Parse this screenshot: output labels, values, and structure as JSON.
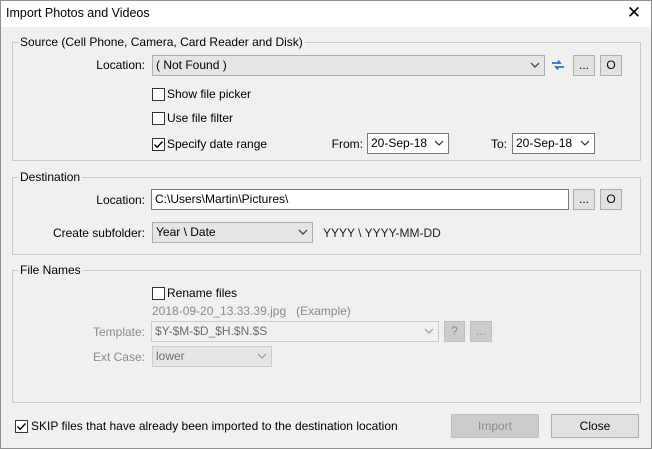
{
  "window": {
    "title": "Import Photos and Videos",
    "close_glyph": "✕"
  },
  "source": {
    "legend": "Source (Cell Phone, Camera, Card Reader and Disk)",
    "location_label": "Location:",
    "location_value": "( Not Found )",
    "browse_label": "...",
    "open_label": "O",
    "show_file_picker": "Show file picker",
    "show_file_picker_checked": false,
    "use_file_filter": "Use file filter",
    "use_file_filter_checked": false,
    "specify_date_range": "Specify date range",
    "specify_date_range_checked": true,
    "from_label": "From:",
    "from_value": "20-Sep-18",
    "to_label": "To:",
    "to_value": "20-Sep-18"
  },
  "destination": {
    "legend": "Destination",
    "location_label": "Location:",
    "location_value": "C:\\Users\\Martin\\Pictures\\",
    "browse_label": "...",
    "open_label": "O",
    "subfolder_label": "Create subfolder:",
    "subfolder_value": "Year \\ Date",
    "subfolder_pattern": "YYYY \\ YYYY-MM-DD"
  },
  "file_names": {
    "legend": "File Names",
    "rename_files": "Rename files",
    "rename_files_checked": false,
    "example": "2018-09-20_13.33.39.jpg   (Example)",
    "template_label": "Template:",
    "template_value": "$Y-$M-$D_$H.$N.$S",
    "help_label": "?",
    "more_label": "...",
    "ext_case_label": "Ext Case:",
    "ext_case_value": "lower"
  },
  "footer": {
    "skip_label": "SKIP files that have already been imported to the destination location",
    "skip_checked": true,
    "import_label": "Import",
    "close_label": "Close"
  },
  "colors": {
    "refresh_icon": "#1e74d0"
  }
}
